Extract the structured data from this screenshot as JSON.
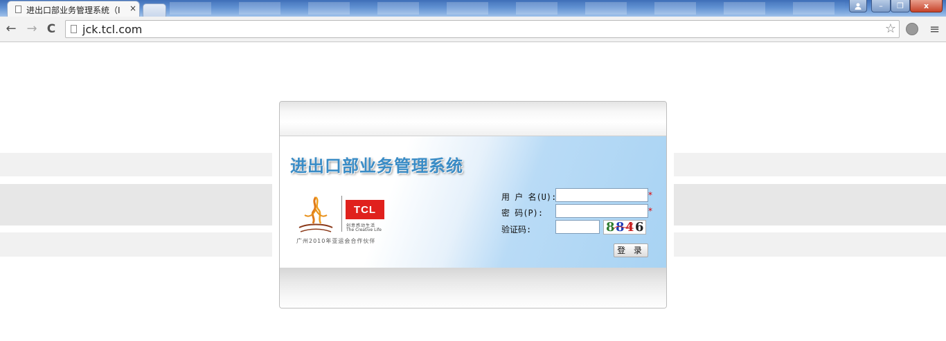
{
  "browser": {
    "tab_title": "进出口部业务管理系统（I",
    "tab_close": "×",
    "url": "jck.tcl.com",
    "back": "←",
    "forward": "→",
    "reload": "C",
    "star": "☆",
    "menu": "≡",
    "window_buttons": {
      "minimize": "–",
      "maximize": "❐",
      "close": "x"
    }
  },
  "login": {
    "system_title": "进出口部业务管理系统",
    "username_label": "用 户 名(U):",
    "password_label": "密   码(P):",
    "captcha_label": "验证码:",
    "required_mark": "*",
    "captcha_chars": [
      "8",
      "8",
      "4",
      "6"
    ],
    "captcha_colors": [
      "#2c7a2c",
      "#1f3fb8",
      "#c81e1e",
      "#222222"
    ],
    "login_button": "登 录"
  },
  "branding": {
    "tcl_logo": "TCL",
    "tcl_cn": "创意感动生活",
    "tcl_en": "The Creative Life",
    "partner": "广州2010年亚运会合作伙伴"
  }
}
